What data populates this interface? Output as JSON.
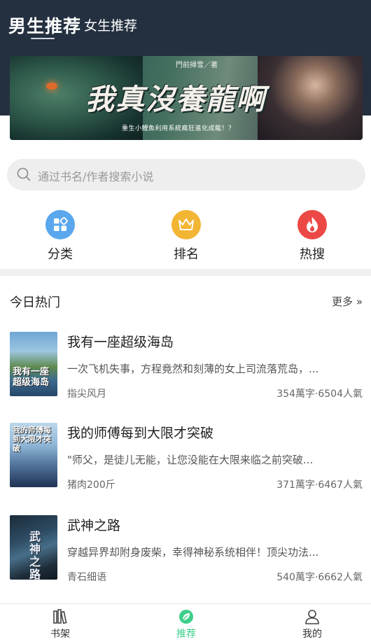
{
  "header": {
    "tabs": [
      {
        "label": "男生推荐",
        "active": true
      },
      {
        "label": "女生推荐",
        "active": false
      }
    ]
  },
  "banner": {
    "author": "門前掃雪／著",
    "title": "我真沒養龍啊",
    "subtitle": "重生小鯉魚利用系統瘋狂進化成龍！？"
  },
  "search": {
    "placeholder": "通过书名/作者搜索小说",
    "icon": "search-icon"
  },
  "quick_actions": [
    {
      "label": "分类",
      "icon": "category-icon",
      "color": "#5aa7ee"
    },
    {
      "label": "排名",
      "icon": "crown-icon",
      "color": "#f2b534"
    },
    {
      "label": "热搜",
      "icon": "flame-icon",
      "color": "#ec4845"
    }
  ],
  "section": {
    "title": "今日热门",
    "more": "更多"
  },
  "books": [
    {
      "title": "我有一座超级海岛",
      "desc": "一次飞机失事，方程竟然和刻薄的女上司流落荒岛，...",
      "author": "指尖风月",
      "stats": "354萬字·6504人氣",
      "cover_text": "我有一座超级海岛"
    },
    {
      "title": "我的师傅每到大限才突破",
      "desc": "\"师父，是徒儿无能，让您没能在大限来临之前突破...",
      "author": "猪肉200斤",
      "stats": "371萬字·6467人氣",
      "cover_text": "我的师傅每到大限才突破"
    },
    {
      "title": "武神之路",
      "desc": "穿越异界却附身废柴，幸得神秘系统相伴！顶尖功法...",
      "author": "青石细语",
      "stats": "540萬字·6662人氣",
      "cover_text": "武神之路"
    }
  ],
  "bottom_nav": [
    {
      "label": "书架",
      "icon": "bookshelf-icon",
      "active": false
    },
    {
      "label": "推荐",
      "icon": "leaf-icon",
      "active": true
    },
    {
      "label": "我的",
      "icon": "user-icon",
      "active": false
    }
  ],
  "colors": {
    "header_bg": "#243040",
    "accent": "#3dcf8a"
  }
}
